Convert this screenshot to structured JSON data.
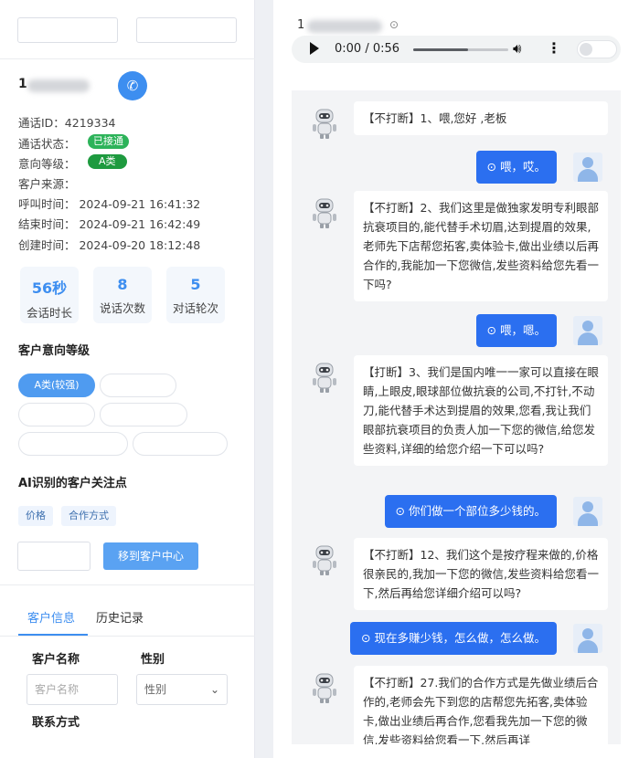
{
  "left": {
    "phone_prefix": "1",
    "call_id": "通话ID：4219334",
    "call_status_label": "通话状态：",
    "call_status_badge": "已接通",
    "intent_label": "意向等级：",
    "intent_badge": "A类",
    "source_label": "客户来源：",
    "call_time": "呼叫时间：  2024-09-21 16:41:32",
    "end_time": "结束时间：  2024-09-21 16:42:49",
    "create_time": "创建时间：  2024-09-20 18:12:48",
    "stats": [
      {
        "num": "56秒",
        "label": "会话时长"
      },
      {
        "num": "8",
        "label": "说话次数"
      },
      {
        "num": "5",
        "label": "对话轮次"
      }
    ],
    "intent_heading": "客户意向等级",
    "intent_selected": "A类(较强)",
    "ai_heading": "AI识别的客户关注点",
    "tags": [
      "价格",
      "合作方式"
    ],
    "move_button": "移到客户中心",
    "tabs": [
      "客户信息",
      "历史记录"
    ],
    "form": {
      "name_label": "客户名称",
      "name_placeholder": "客户名称",
      "gender_label": "性别",
      "gender_placeholder": "性别",
      "contact_label": "联系方式"
    },
    "badge_colors": {
      "status": "#2db35a",
      "intent": "#1e9a3f"
    }
  },
  "right": {
    "header_prefix": "1",
    "audio_time": "0:00 / 0:56",
    "messages": [
      {
        "from": "bot",
        "text": "【不打断】1、喂,您好 ,老板"
      },
      {
        "from": "user",
        "text": "喂，哎。"
      },
      {
        "from": "bot",
        "text": "【不打断】2、我们这里是做独家发明专利眼部抗衰项目的,能代替手术切眉,达到提眉的效果,老师先下店帮您拓客,卖体验卡,做出业绩以后再合作的,我能加一下您微信,发些资料给您先看一下吗?"
      },
      {
        "from": "user",
        "text": "喂，嗯。"
      },
      {
        "from": "bot",
        "text": "【打断】3、我们是国内唯一一家可以直接在眼睛,上眼皮,眼球部位做抗衰的公司,不打针,不动刀,能代替手术达到提眉的效果,您看,我让我们眼部抗衰项目的负责人加一下您的微信,给您发些资料,详细的给您介绍一下可以吗?"
      },
      {
        "from": "user",
        "text": "你们做一个部位多少钱的。"
      },
      {
        "from": "bot",
        "text": "【不打断】12、我们这个是按疗程来做的,价格很亲民的,我加一下您的微信,发些资料给您看一下,然后再给您详细介绍可以吗?"
      },
      {
        "from": "user",
        "text": "现在多赚少钱，怎么做，怎么做。"
      },
      {
        "from": "bot",
        "text": "【不打断】27.我们的合作方式是先做业绩后合作的,老师会先下到您的店帮您先拓客,卖体验卡,做出业绩后再合作,您看我先加一下您的微信,发些资料给您看一下,然后再详"
      }
    ],
    "user_color": "#2b6ff0"
  }
}
